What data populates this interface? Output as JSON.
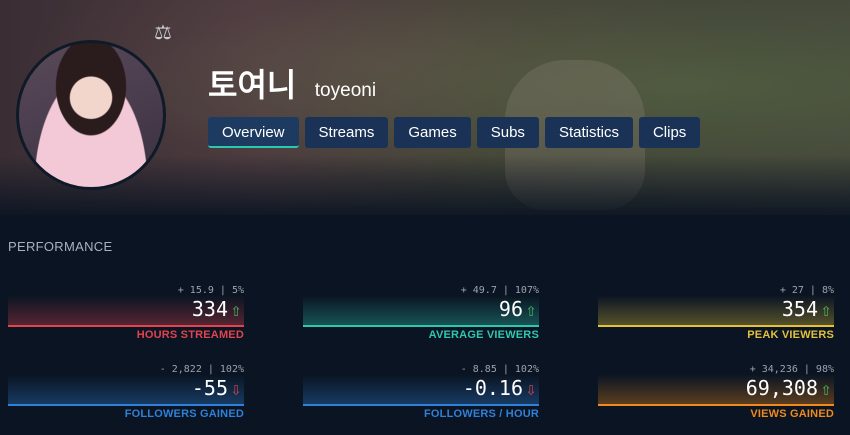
{
  "profile": {
    "display_name": "토여니",
    "login_name": "toyeoni",
    "icon": "scale-icon"
  },
  "tabs": [
    {
      "label": "Overview",
      "active": true
    },
    {
      "label": "Streams",
      "active": false
    },
    {
      "label": "Games",
      "active": false
    },
    {
      "label": "Subs",
      "active": false
    },
    {
      "label": "Statistics",
      "active": false
    },
    {
      "label": "Clips",
      "active": false
    }
  ],
  "performance": {
    "title": "PERFORMANCE",
    "stats": [
      {
        "delta": "+ 15.9 | 5%",
        "value": "334",
        "trend": "up",
        "label": "HOURS STREAMED",
        "color": "#e1444e"
      },
      {
        "delta": "+ 49.7 | 107%",
        "value": "96",
        "trend": "up",
        "label": "AVERAGE VIEWERS",
        "color": "#2ec7b0"
      },
      {
        "delta": "+ 27 | 8%",
        "value": "354",
        "trend": "up",
        "label": "PEAK VIEWERS",
        "color": "#e3c23a"
      },
      {
        "delta": "- 2,822 | 102%",
        "value": "-55",
        "trend": "down",
        "label": "FOLLOWERS GAINED",
        "color": "#2f80d8"
      },
      {
        "delta": "- 8.85 | 102%",
        "value": "-0.16",
        "trend": "down",
        "label": "FOLLOWERS / HOUR",
        "color": "#2f80d8"
      },
      {
        "delta": "+ 34,236 | 98%",
        "value": "69,308",
        "trend": "up",
        "label": "VIEWS GAINED",
        "color": "#f08a1c"
      }
    ]
  },
  "colors": {
    "tab_bg": "#1b3257",
    "tab_active_underline": "#2ec7b0",
    "arrow_up": "#4cc361",
    "arrow_down": "#e1444e"
  }
}
